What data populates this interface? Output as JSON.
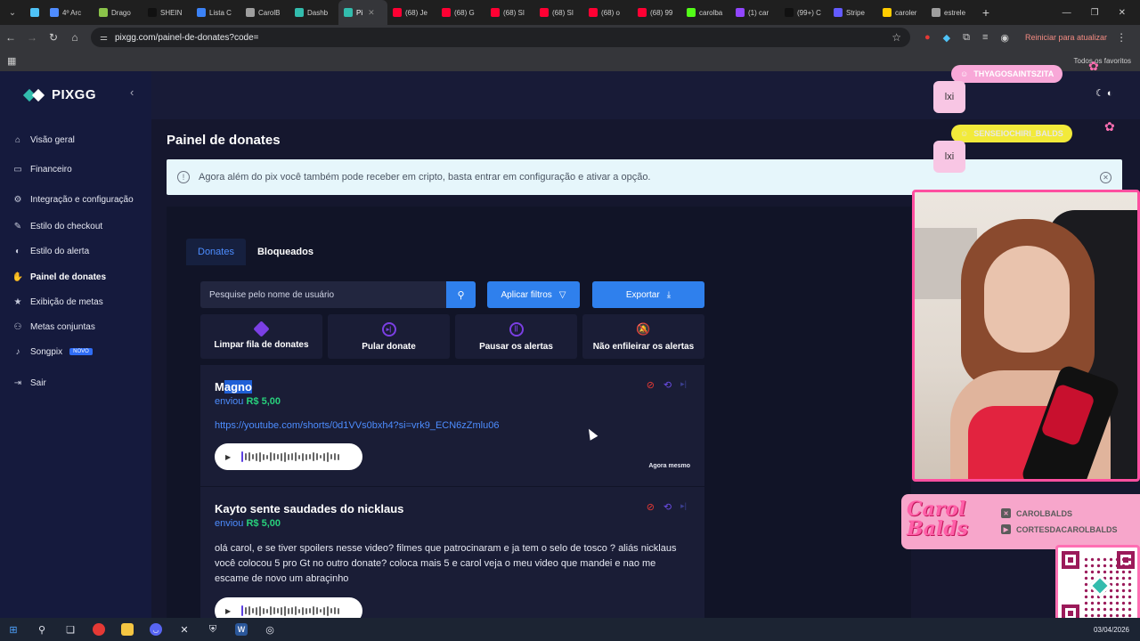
{
  "browser": {
    "tabs": [
      {
        "label": "",
        "color": "#4fc3f7"
      },
      {
        "label": "4º Arc",
        "color": "#4f8cff"
      },
      {
        "label": "Drago",
        "color": "#8bc34a"
      },
      {
        "label": "SHEIN",
        "color": "#111111"
      },
      {
        "label": "Lista C",
        "color": "#3b82f6"
      },
      {
        "label": "CarolB",
        "color": "#9e9e9e"
      },
      {
        "label": "Dashb",
        "color": "#32bcad"
      },
      {
        "label": "Pi",
        "color": "#32bcad",
        "active": true
      },
      {
        "label": "(68) Je",
        "color": "#ff0033"
      },
      {
        "label": "(68) G",
        "color": "#ff0033"
      },
      {
        "label": "(68) SI",
        "color": "#ff0033"
      },
      {
        "label": "(68) SI",
        "color": "#ff0033"
      },
      {
        "label": "(68) o",
        "color": "#ff0033"
      },
      {
        "label": "(68) 99",
        "color": "#ff0033"
      },
      {
        "label": "carolba",
        "color": "#53fc18"
      },
      {
        "label": "(1) car",
        "color": "#9146ff"
      },
      {
        "label": "(99+) C",
        "color": "#111111"
      },
      {
        "label": "Stripe",
        "color": "#635bff"
      },
      {
        "label": "caroler",
        "color": "#ffcc00"
      },
      {
        "label": "estrele",
        "color": "#9e9e9e"
      }
    ],
    "new_tab": "+",
    "url": "pixgg.com/painel-de-donates?code=",
    "update_button": "Reiniciar para atualizar",
    "all_favorites": "Todos os favoritos"
  },
  "sidebar": {
    "logo": "PIXGG",
    "items": [
      {
        "label": "Visão geral",
        "icon": "home-icon",
        "glyph": "⌂"
      },
      {
        "label": "Financeiro",
        "icon": "card-icon",
        "glyph": "▭"
      },
      {
        "label": "Integração e configuração",
        "icon": "gear-icon",
        "glyph": "⚙"
      },
      {
        "label": "Estilo do checkout",
        "icon": "brush-icon",
        "glyph": "✎"
      },
      {
        "label": "Estilo do alerta",
        "icon": "palette-icon",
        "glyph": "◐"
      },
      {
        "label": "Painel de donates",
        "icon": "hand-coin-icon",
        "glyph": "✋",
        "active": true
      },
      {
        "label": "Exibição de metas",
        "icon": "star-icon",
        "glyph": "★"
      },
      {
        "label": "Metas conjuntas",
        "icon": "users-icon",
        "glyph": "⚇"
      },
      {
        "label": "Songpix",
        "icon": "music-icon",
        "glyph": "♪",
        "badge": "NOVO"
      },
      {
        "label": "Sair",
        "icon": "logout-icon",
        "glyph": "⇥"
      }
    ]
  },
  "main": {
    "title": "Painel de donates",
    "info_banner": "Agora além do pix você também pode receber em cripto, basta entrar em configuração e ativar a opção.",
    "tabs": [
      "Donates",
      "Bloqueados"
    ],
    "search_placeholder": "Pesquise pelo nome de usuário",
    "apply_filters": "Aplicar filtros",
    "export": "Exportar",
    "actions": [
      "Limpar fila de donates",
      "Pular donate",
      "Pausar os alertas",
      "Não enfileirar os alertas"
    ],
    "donates": [
      {
        "name_prefix": "M",
        "name_highlight": "agno",
        "sent_label": "enviou",
        "amount": "R$ 5,00",
        "link": "https://youtube.com/shorts/0d1VVs0bxh4?si=vrk9_ECN6zZmlu06",
        "time": "Agora mesmo"
      },
      {
        "name": "Kayto sente saudades do nicklaus",
        "sent_label": "enviou",
        "amount": "R$ 5,00",
        "message": "olá carol, e se tiver spoilers nesse video? filmes que patrocinaram e ja tem o selo de tosco ? aliás nicklaus você colocou 5 pro Gt no outro donate? coloca mais 5 e carol veja o meu video que mandei e nao me escame de novo um abraçinho"
      }
    ]
  },
  "overlay": {
    "chat": [
      {
        "user": "THYAGOSAINTSZITA",
        "message": "lxi"
      },
      {
        "user": "SENSEIOCHIRI_BALDS",
        "message": "lxi"
      }
    ],
    "brand": "Carol Balds",
    "socials": [
      "CAROLBALDS",
      "CORTESDACAROLBALDS"
    ]
  },
  "taskbar": {
    "date": "03/04/2026"
  }
}
